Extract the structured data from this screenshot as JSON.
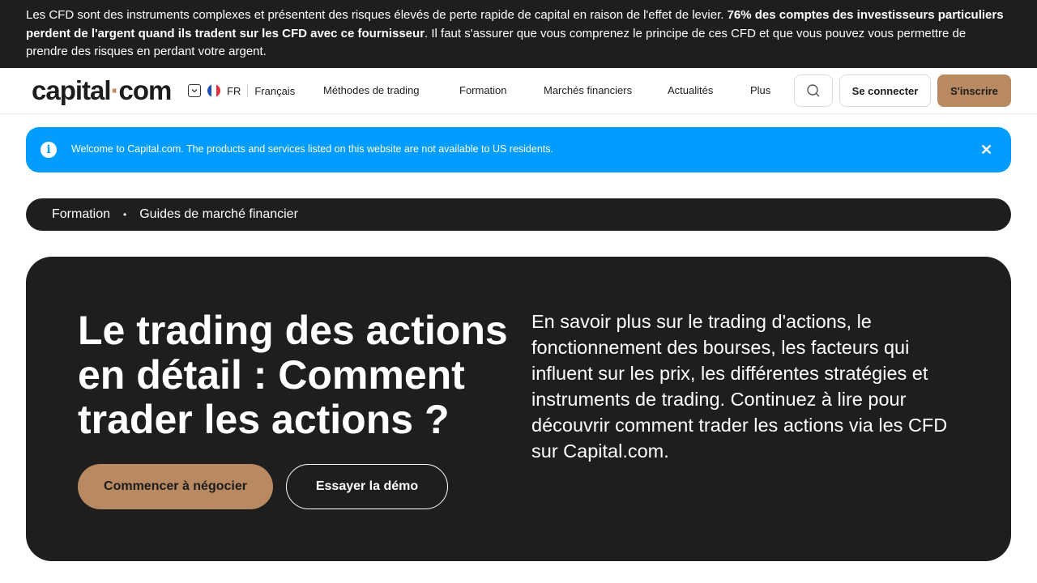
{
  "risk_warning": {
    "part1": "Les CFD sont des instruments complexes et présentent des risques élevés de perte rapide de capital en raison de l'effet de levier. ",
    "bold": "76% des comptes des investisseurs particuliers perdent de l'argent quand ils tradent sur les CFD avec ce fournisseur",
    "part2": ". Il faut s'assurer que vous comprenez le principe de ces CFD et que vous pouvez vous permettre de prendre des risques en perdant votre argent."
  },
  "header": {
    "logo_main": "capital",
    "logo_dot": "·",
    "logo_end": "com",
    "lang_code": "FR",
    "lang_name": "Français",
    "menu": [
      "Méthodes de trading",
      "Formation",
      "Marchés financiers",
      "Actualités",
      "Plus"
    ],
    "login_label": "Se connecter",
    "signup_label": "S'inscrire",
    "icons": {
      "search": "search-icon",
      "chevron": "chevron-down-icon",
      "flag": "france-flag-icon"
    }
  },
  "banner": {
    "message": "Welcome to Capital.com. The products and services listed on this website are not available to US residents.",
    "info_glyph": "i",
    "close_glyph": "✕",
    "color": "#009cff"
  },
  "breadcrumb": {
    "items": [
      "Formation",
      "Guides de marché financier"
    ],
    "separator": "•"
  },
  "hero": {
    "title": "Le trading des actions en détail : Comment trader les actions ?",
    "description": "En savoir plus sur le trading d'actions, le fonctionnement des bourses, les facteurs qui influent sur les prix, les différentes stratégies et instruments de trading. Continuez à lire pour découvrir comment trader les actions via les CFD sur Capital.com.",
    "primary_button": "Commencer à négocier",
    "secondary_button": "Essayer la démo",
    "accent_color": "#b98a61"
  }
}
